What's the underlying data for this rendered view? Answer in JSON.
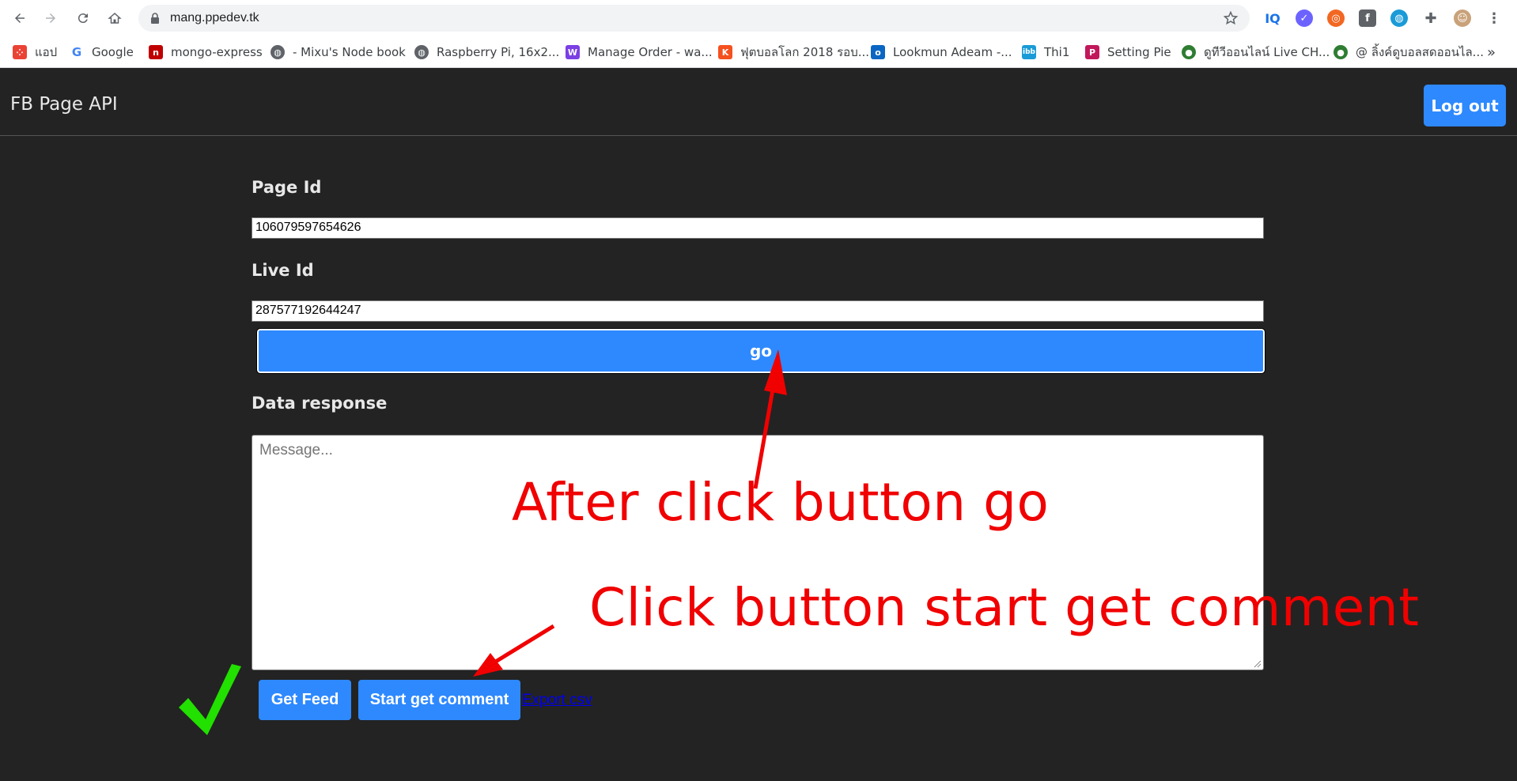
{
  "browser": {
    "url": "mang.ppedev.tk",
    "bookmarks": [
      {
        "label": "แอป",
        "icon": "apps-grid-icon",
        "color": "#ea4335"
      },
      {
        "label": "Google",
        "icon": "google-icon",
        "color": "#4285f4"
      },
      {
        "label": "mongo-express",
        "icon": "mongo-express-icon",
        "color": "#c00000"
      },
      {
        "label": "- Mixu's Node book",
        "icon": "globe-icon",
        "color": "#5f6368"
      },
      {
        "label": "Raspberry Pi, 16x2...",
        "icon": "globe-icon",
        "color": "#5f6368"
      },
      {
        "label": "Manage Order - wa...",
        "icon": "wap-icon",
        "color": "#7b3fe4"
      },
      {
        "label": "ฟุตบอลโลก 2018 รอบ...",
        "icon": "k-icon",
        "color": "#f4511e"
      },
      {
        "label": "Lookmun Adeam -...",
        "icon": "outlook-icon",
        "color": "#0a66c2"
      },
      {
        "label": "Thi1",
        "icon": "ibb-icon",
        "color": "#1a9bd7"
      },
      {
        "label": "Setting Pie",
        "icon": "pie-icon",
        "color": "#c2185b"
      },
      {
        "label": "ดูทีวีออนไลน์ Live CH...",
        "icon": "tv-icon",
        "color": "#2e7d32"
      },
      {
        "label": "@ ลิ้งค์ดูบอลสดออนไล...",
        "icon": "tv-icon",
        "color": "#2e7d32"
      }
    ],
    "more": "»"
  },
  "navbar": {
    "brand": "FB Page API",
    "logout_label": "Log out"
  },
  "form": {
    "page_id_label": "Page Id",
    "page_id_value": "106079597654626",
    "live_id_label": "Live Id",
    "live_id_value": "287577192644247",
    "go_label": "go",
    "data_response_label": "Data response",
    "message_placeholder": "Message...",
    "get_feed_label": "Get Feed",
    "start_comment_label": "Start get comment",
    "export_label": "Export csv"
  },
  "annotations": {
    "after_click": "After click button go",
    "click_start": "Click button start get comment",
    "arrow_color": "#f00000",
    "check_color": "#22e000"
  }
}
